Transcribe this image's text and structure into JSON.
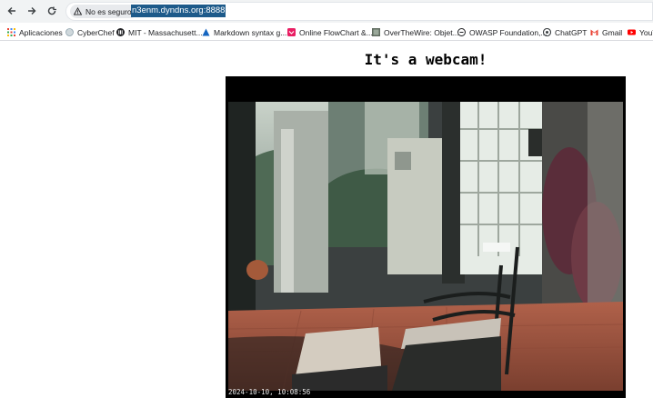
{
  "browser": {
    "security_label": "No es seguro",
    "url": "n3enm.dyndns.org:8888"
  },
  "bookmarks": [
    {
      "label": "Aplicaciones",
      "icon": "apps-grid-icon"
    },
    {
      "label": "CyberChef",
      "icon": "cyberchef-icon"
    },
    {
      "label": "MIT - Massachusett...",
      "icon": "mit-icon"
    },
    {
      "label": "Markdown syntax g...",
      "icon": "markdown-icon"
    },
    {
      "label": "Online FlowChart &...",
      "icon": "flowchart-icon"
    },
    {
      "label": "OverTheWire: Objet...",
      "icon": "overthewire-icon"
    },
    {
      "label": "OWASP Foundation,...",
      "icon": "owasp-icon"
    },
    {
      "label": "ChatGPT",
      "icon": "chatgpt-icon"
    },
    {
      "label": "Gmail",
      "icon": "gmail-icon"
    },
    {
      "label": "YouT",
      "icon": "youtube-icon"
    }
  ],
  "page": {
    "title": "It's a webcam!",
    "timestamp": "2024-10-10, 10:08:56"
  },
  "colors": {
    "url_highlight": "#1d5a8a",
    "frame": "#000000"
  }
}
